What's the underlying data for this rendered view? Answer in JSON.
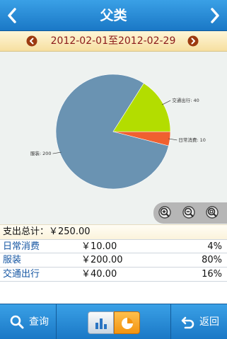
{
  "header": {
    "title": "父类",
    "back_icon": "chevron-left-icon",
    "forward_icon": "chevron-right-icon"
  },
  "date_range": {
    "text": "2012-02-01至2012-02-29",
    "prev_icon": "prev-circle-icon",
    "next_icon": "next-circle-icon"
  },
  "chart_data": {
    "type": "pie",
    "slices": [
      {
        "label": "日常消费: 10",
        "value": 10,
        "color": "#f06030"
      },
      {
        "label": "服装: 200",
        "value": 200,
        "color": "#6a93b2"
      },
      {
        "label": "交通出行: 40",
        "value": 40,
        "color": "#b3dd00"
      }
    ]
  },
  "zoom_controls": {
    "icons": [
      "zoom-in-icon",
      "zoom-out-icon",
      "zoom-reset-icon"
    ]
  },
  "summary": {
    "text": "支出总计：￥250.00"
  },
  "items": [
    {
      "name": "日常消费",
      "amount": "￥10.00",
      "percent": "4%"
    },
    {
      "name": "服装",
      "amount": "￥200.00",
      "percent": "80%"
    },
    {
      "name": "交通出行",
      "amount": "￥40.00",
      "percent": "16%"
    }
  ],
  "toolbar": {
    "query_label": "查询",
    "back_label": "返回",
    "view_toggle": [
      "bar-chart-icon",
      "pie-chart-icon"
    ],
    "active_view": "pie",
    "accent": "#f39410"
  },
  "colors": {
    "brand_blue": "#1a78c6",
    "name_blue": "#1757a3",
    "date_red": "#8b1a1a"
  }
}
